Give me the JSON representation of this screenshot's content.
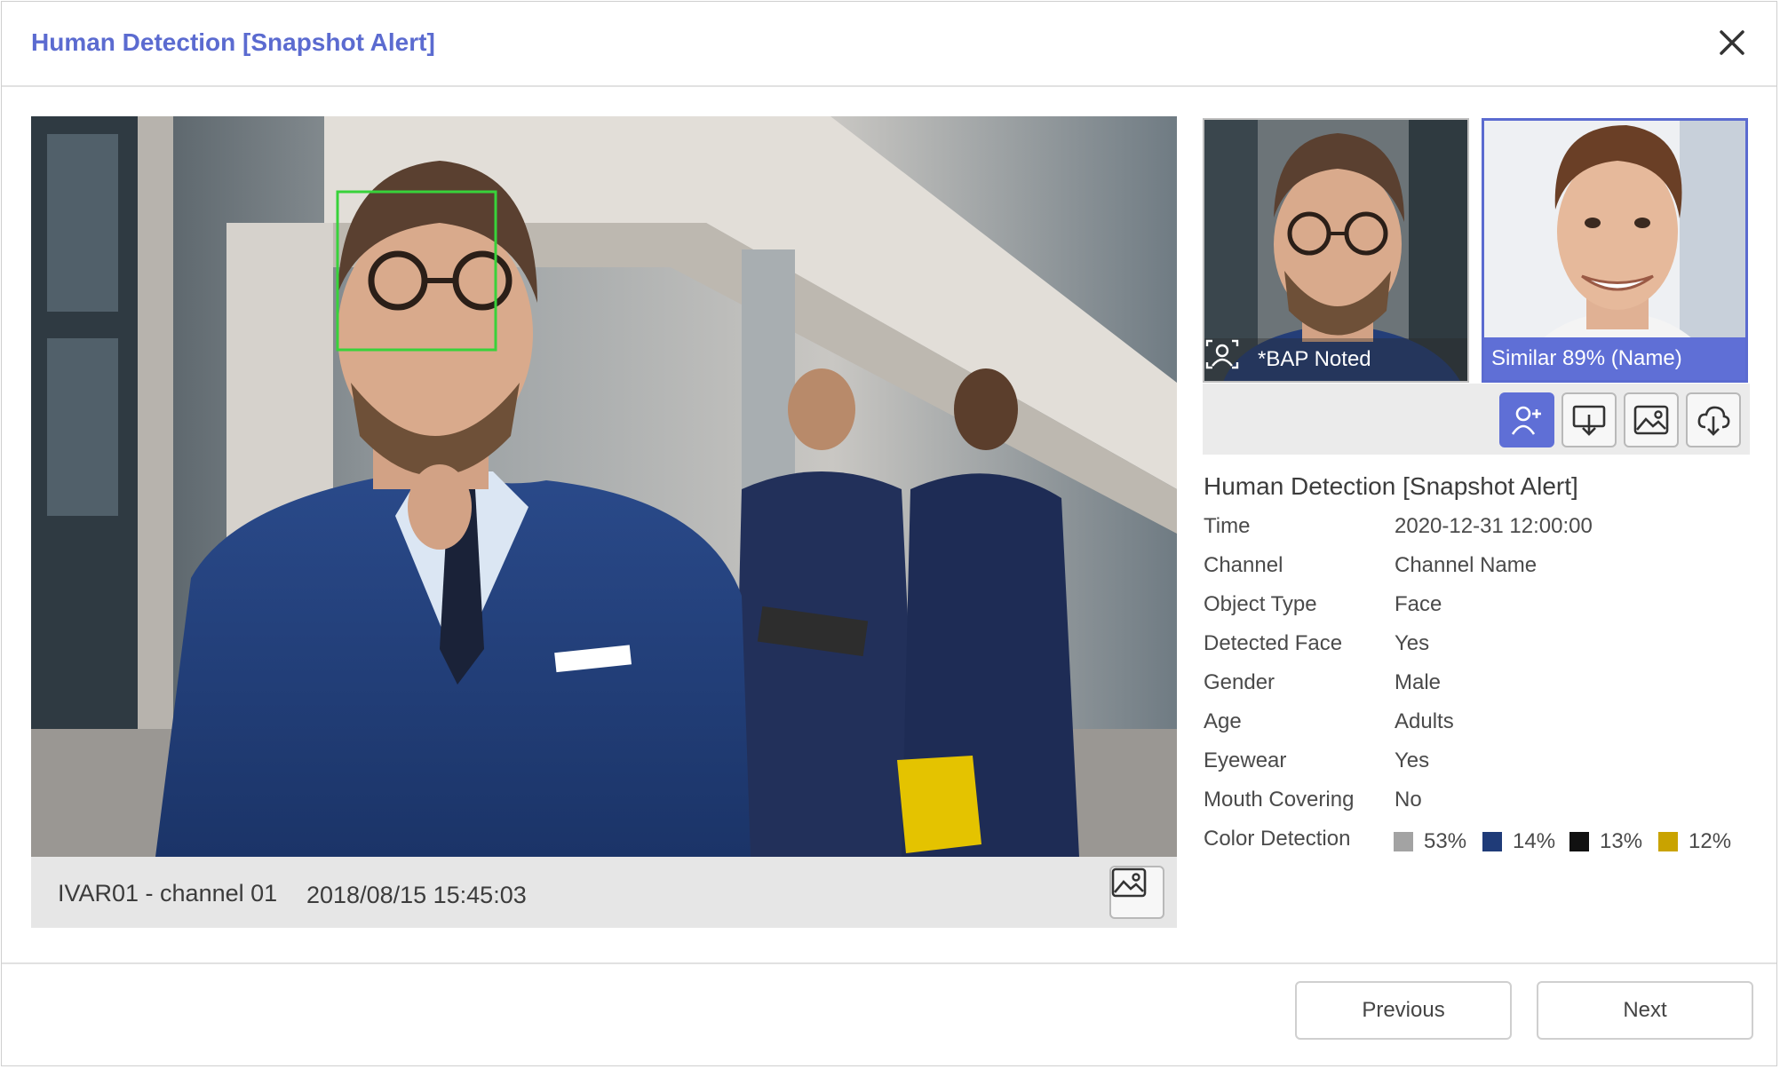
{
  "dialog": {
    "title": "Human Detection [Snapshot Alert]"
  },
  "main_image": {
    "channel": "IVAR01 - channel 01",
    "datetime": "2018/08/15 15:45:03"
  },
  "thumbnails": [
    {
      "label": "*BAP Noted"
    },
    {
      "label": "Similar 89%   (Name)"
    }
  ],
  "info": {
    "title": "Human Detection [Snapshot Alert]",
    "rows": [
      {
        "label": "Time",
        "value": "2020-12-31 12:00:00"
      },
      {
        "label": "Channel",
        "value": "Channel Name"
      },
      {
        "label": "Object Type",
        "value": "Face"
      },
      {
        "label": "Detected Face",
        "value": "Yes"
      },
      {
        "label": "Gender",
        "value": "Male"
      },
      {
        "label": "Age",
        "value": "Adults"
      },
      {
        "label": "Eyewear",
        "value": "Yes"
      },
      {
        "label": "Mouth Covering",
        "value": "No"
      },
      {
        "label": "Color Detection",
        "value": ""
      }
    ],
    "colors": [
      {
        "color": "#a3a3a3",
        "percent": "53%"
      },
      {
        "color": "#1f3b78",
        "percent": "14%"
      },
      {
        "color": "#111111",
        "percent": "13%"
      },
      {
        "color": "#c9a300",
        "percent": "12%"
      }
    ]
  },
  "buttons": {
    "previous": "Previous",
    "next": "Next"
  },
  "accent_color": "#5b6bd0"
}
